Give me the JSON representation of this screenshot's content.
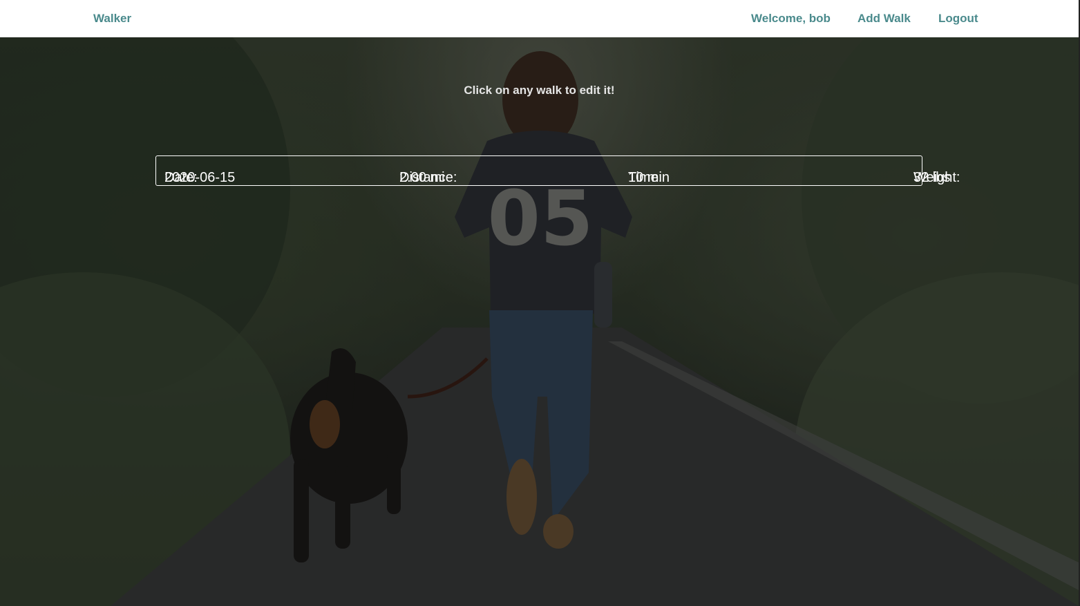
{
  "navbar": {
    "brand": "Walker",
    "welcome": "Welcome, bob",
    "add_walk": "Add Walk",
    "logout": "Logout"
  },
  "main": {
    "instruction": "Click on any walk to edit it!",
    "walks": [
      {
        "date_label": "Date:",
        "date": "2020-06-15",
        "distance_label": "Distance:",
        "distance": "2.00 mi",
        "time_label": "Time:",
        "time": "10 min",
        "weight_label": "Weight:",
        "weight": "32 lbs"
      }
    ]
  },
  "colors": {
    "nav_link": "#4a8a8c",
    "nav_background": "#ffffff",
    "text_on_photo": "#ffffff"
  },
  "background_image": "person-walking-dog-on-forest-path"
}
